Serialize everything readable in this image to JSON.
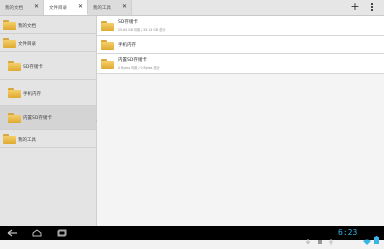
{
  "tabs": [
    {
      "label": "我的文档",
      "close": "✕",
      "active": false
    },
    {
      "label": "文件目录",
      "close": "✕",
      "active": true
    },
    {
      "label": "我的工具",
      "close": "✕",
      "active": false
    }
  ],
  "toolbar": {
    "add": "+"
  },
  "sidebar": {
    "items": [
      {
        "label": "我的文档"
      },
      {
        "label": "文件目录"
      },
      {
        "label": "SD存储卡"
      },
      {
        "label": "手机内存"
      },
      {
        "label": "内置SD存储卡"
      },
      {
        "label": "我的工具"
      }
    ]
  },
  "main": {
    "rows": [
      {
        "name": "SD存储卡",
        "sub": "25.64 GB 可用 / 29.14 GB 总计"
      },
      {
        "name": "手机内存",
        "sub": ""
      },
      {
        "name": "内置SD存储卡",
        "sub": "0 Bytes 可用 / 0 Bytes 总计"
      }
    ]
  },
  "statusbar": {
    "time": "6:23"
  },
  "colors": {
    "clock": "#37b6e6",
    "folder": "#f0c04a"
  }
}
